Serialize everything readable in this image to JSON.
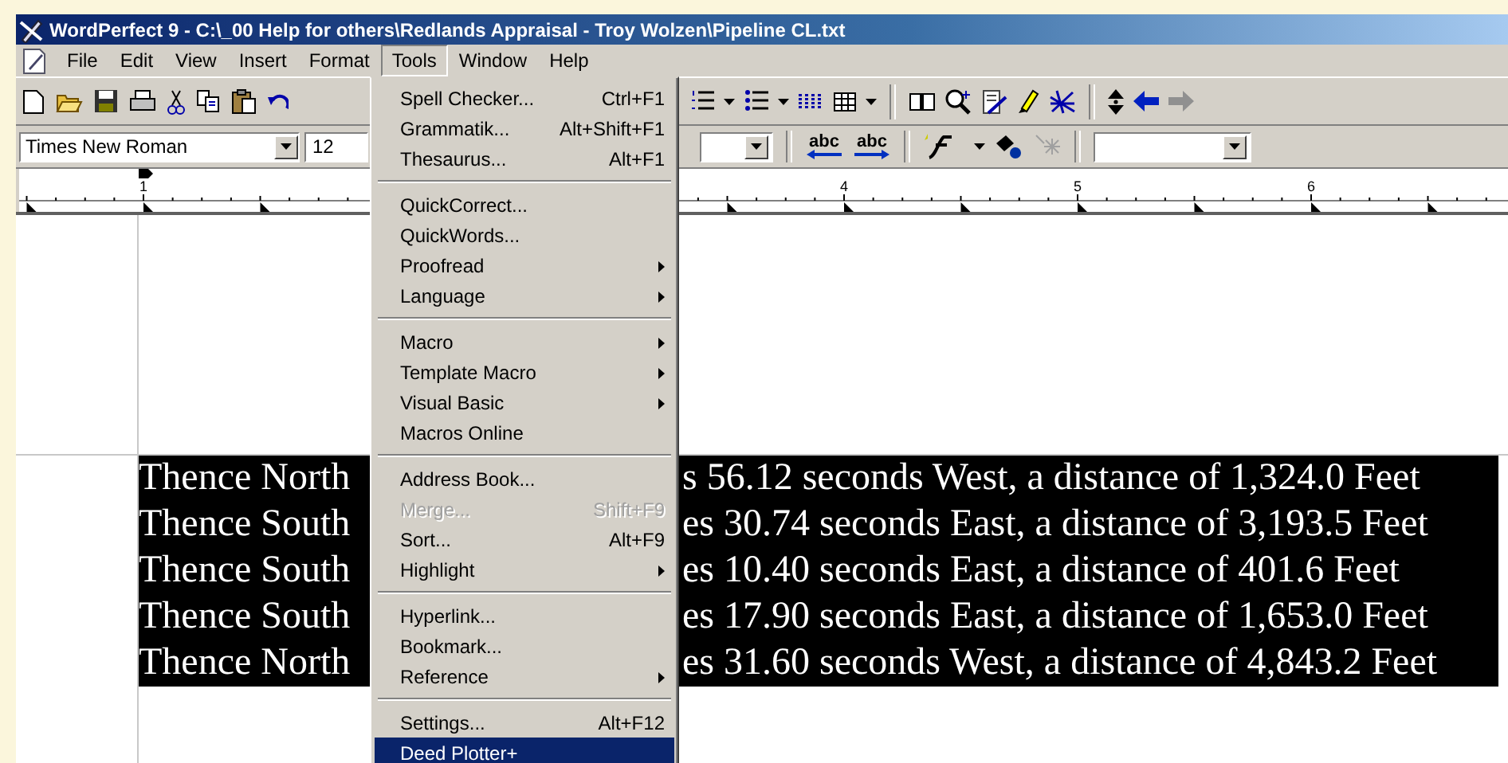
{
  "window": {
    "title": "WordPerfect 9 - C:\\_00 Help for others\\Redlands Appraisal - Troy Wolzen\\Pipeline CL.txt"
  },
  "menubar": [
    {
      "label": "File",
      "selected": false
    },
    {
      "label": "Edit",
      "selected": false
    },
    {
      "label": "View",
      "selected": false
    },
    {
      "label": "Insert",
      "selected": false
    },
    {
      "label": "Format",
      "selected": false
    },
    {
      "label": "Tools",
      "selected": true
    },
    {
      "label": "Window",
      "selected": false
    },
    {
      "label": "Help",
      "selected": false
    }
  ],
  "property_bar": {
    "font": {
      "value": "Times New Roman"
    },
    "size": {
      "value": "12"
    },
    "text_buttons": [
      {
        "label": "abc"
      },
      {
        "label": "abc"
      }
    ]
  },
  "ruler": {
    "numbers": [
      "1",
      "4",
      "5",
      "6"
    ]
  },
  "document": {
    "lines": [
      {
        "left": "Thence North",
        "right": "s 56.12 seconds West, a distance of 1,324.0 Feet",
        "selected": true
      },
      {
        "left": "Thence South",
        "right": "es 30.74 seconds East, a distance of 3,193.5 Feet",
        "selected": true
      },
      {
        "left": "Thence South",
        "right": "es 10.40 seconds East, a distance of 401.6 Feet",
        "selected": true
      },
      {
        "left": "Thence South",
        "right": "es 17.90 seconds East, a distance of 1,653.0 Feet",
        "selected": true
      },
      {
        "left": "Thence North",
        "right": "es 31.60 seconds West, a distance of 4,843.2 Feet",
        "selected": true
      }
    ]
  },
  "tools_menu": {
    "items": [
      {
        "kind": "item",
        "label": "Spell Checker...",
        "shortcut": "Ctrl+F1",
        "submenu": false,
        "disabled": false,
        "selected": false
      },
      {
        "kind": "item",
        "label": "Grammatik...",
        "shortcut": "Alt+Shift+F1",
        "submenu": false,
        "disabled": false,
        "selected": false
      },
      {
        "kind": "item",
        "label": "Thesaurus...",
        "shortcut": "Alt+F1",
        "submenu": false,
        "disabled": false,
        "selected": false
      },
      {
        "kind": "separator"
      },
      {
        "kind": "item",
        "label": "QuickCorrect...",
        "submenu": false,
        "disabled": false,
        "selected": false
      },
      {
        "kind": "item",
        "label": "QuickWords...",
        "submenu": false,
        "disabled": false,
        "selected": false
      },
      {
        "kind": "item",
        "label": "Proofread",
        "submenu": true,
        "disabled": false,
        "selected": false
      },
      {
        "kind": "item",
        "label": "Language",
        "submenu": true,
        "disabled": false,
        "selected": false
      },
      {
        "kind": "separator"
      },
      {
        "kind": "item",
        "label": "Macro",
        "submenu": true,
        "disabled": false,
        "selected": false
      },
      {
        "kind": "item",
        "label": "Template Macro",
        "submenu": true,
        "disabled": false,
        "selected": false
      },
      {
        "kind": "item",
        "label": "Visual Basic",
        "submenu": true,
        "disabled": false,
        "selected": false
      },
      {
        "kind": "item",
        "label": "Macros Online",
        "submenu": false,
        "disabled": false,
        "selected": false
      },
      {
        "kind": "separator"
      },
      {
        "kind": "item",
        "label": "Address Book...",
        "submenu": false,
        "disabled": false,
        "selected": false
      },
      {
        "kind": "item",
        "label": "Merge...",
        "shortcut": "Shift+F9",
        "submenu": false,
        "disabled": true,
        "selected": false
      },
      {
        "kind": "item",
        "label": "Sort...",
        "shortcut": "Alt+F9",
        "submenu": false,
        "disabled": false,
        "selected": false
      },
      {
        "kind": "item",
        "label": "Highlight",
        "submenu": true,
        "disabled": false,
        "selected": false
      },
      {
        "kind": "separator"
      },
      {
        "kind": "item",
        "label": "Hyperlink...",
        "submenu": false,
        "disabled": false,
        "selected": false
      },
      {
        "kind": "item",
        "label": "Bookmark...",
        "submenu": false,
        "disabled": false,
        "selected": false
      },
      {
        "kind": "item",
        "label": "Reference",
        "submenu": true,
        "disabled": false,
        "selected": false
      },
      {
        "kind": "separator"
      },
      {
        "kind": "item",
        "label": "Settings...",
        "shortcut": "Alt+F12",
        "submenu": false,
        "disabled": false,
        "selected": false
      },
      {
        "kind": "item",
        "label": "Deed Plotter+",
        "submenu": false,
        "disabled": false,
        "selected": true
      }
    ]
  }
}
